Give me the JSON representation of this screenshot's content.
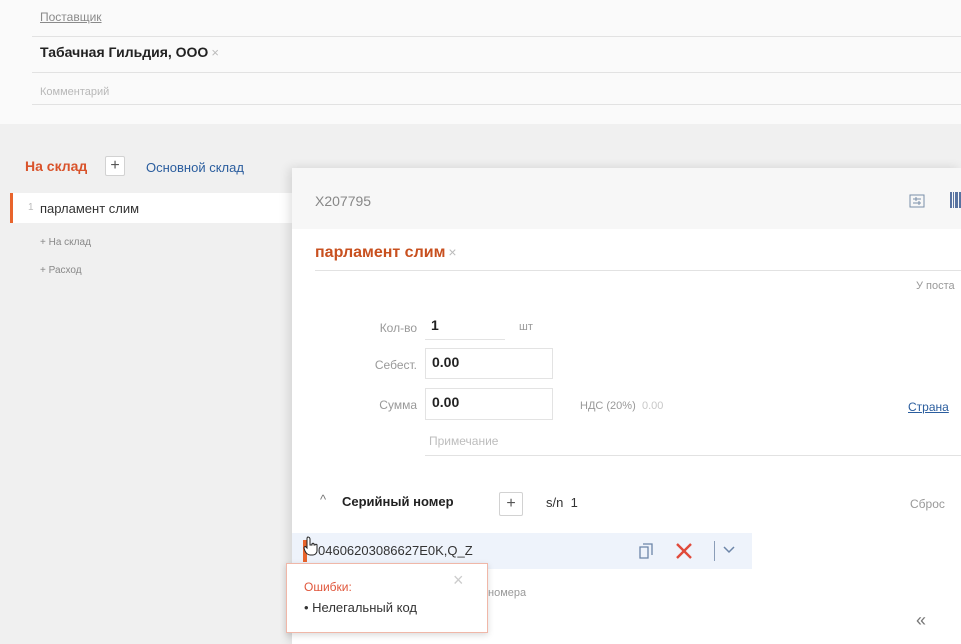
{
  "supplier": {
    "label": "Поставщик",
    "value": "Табачная Гильдия, ООО",
    "clear": "×",
    "comment_placeholder": "Комментарий"
  },
  "store": {
    "to_store_label": "На склад",
    "add": "+",
    "main_store": "Основной склад"
  },
  "items": [
    {
      "num": "1",
      "name": "парламент слим"
    }
  ],
  "item_actions": {
    "to_store": "+ На склад",
    "expense": "+ Расход"
  },
  "modal": {
    "doc_id": "X207795",
    "product": "парламент слим",
    "product_clear": "×",
    "supplier_hint": "У поста",
    "qty_label": "Кол-во",
    "qty_value": "1",
    "qty_unit": "шт",
    "cost_label": "Себест.",
    "cost_value": "0.00",
    "sum_label": "Сумма",
    "sum_value": "0.00",
    "vat_label": "НДС (20%)",
    "vat_value": "0.00",
    "country_link": "Страна",
    "note_placeholder": "Примечание",
    "serial": {
      "toggle": "^",
      "title": "Серийный номер",
      "add": "+",
      "sn_label": "s/n",
      "sn_count": "1",
      "reset": "Сброс",
      "value": "04606203086627E0K,Q_Z",
      "hint_suffix": "номера"
    },
    "pager_prev": "«"
  },
  "error": {
    "title": "Ошибки:",
    "item": "• Нелегальный код",
    "close": "×"
  },
  "colors": {
    "accent": "#e8642c",
    "link": "#2a5d9e",
    "error": "#e0563b"
  }
}
